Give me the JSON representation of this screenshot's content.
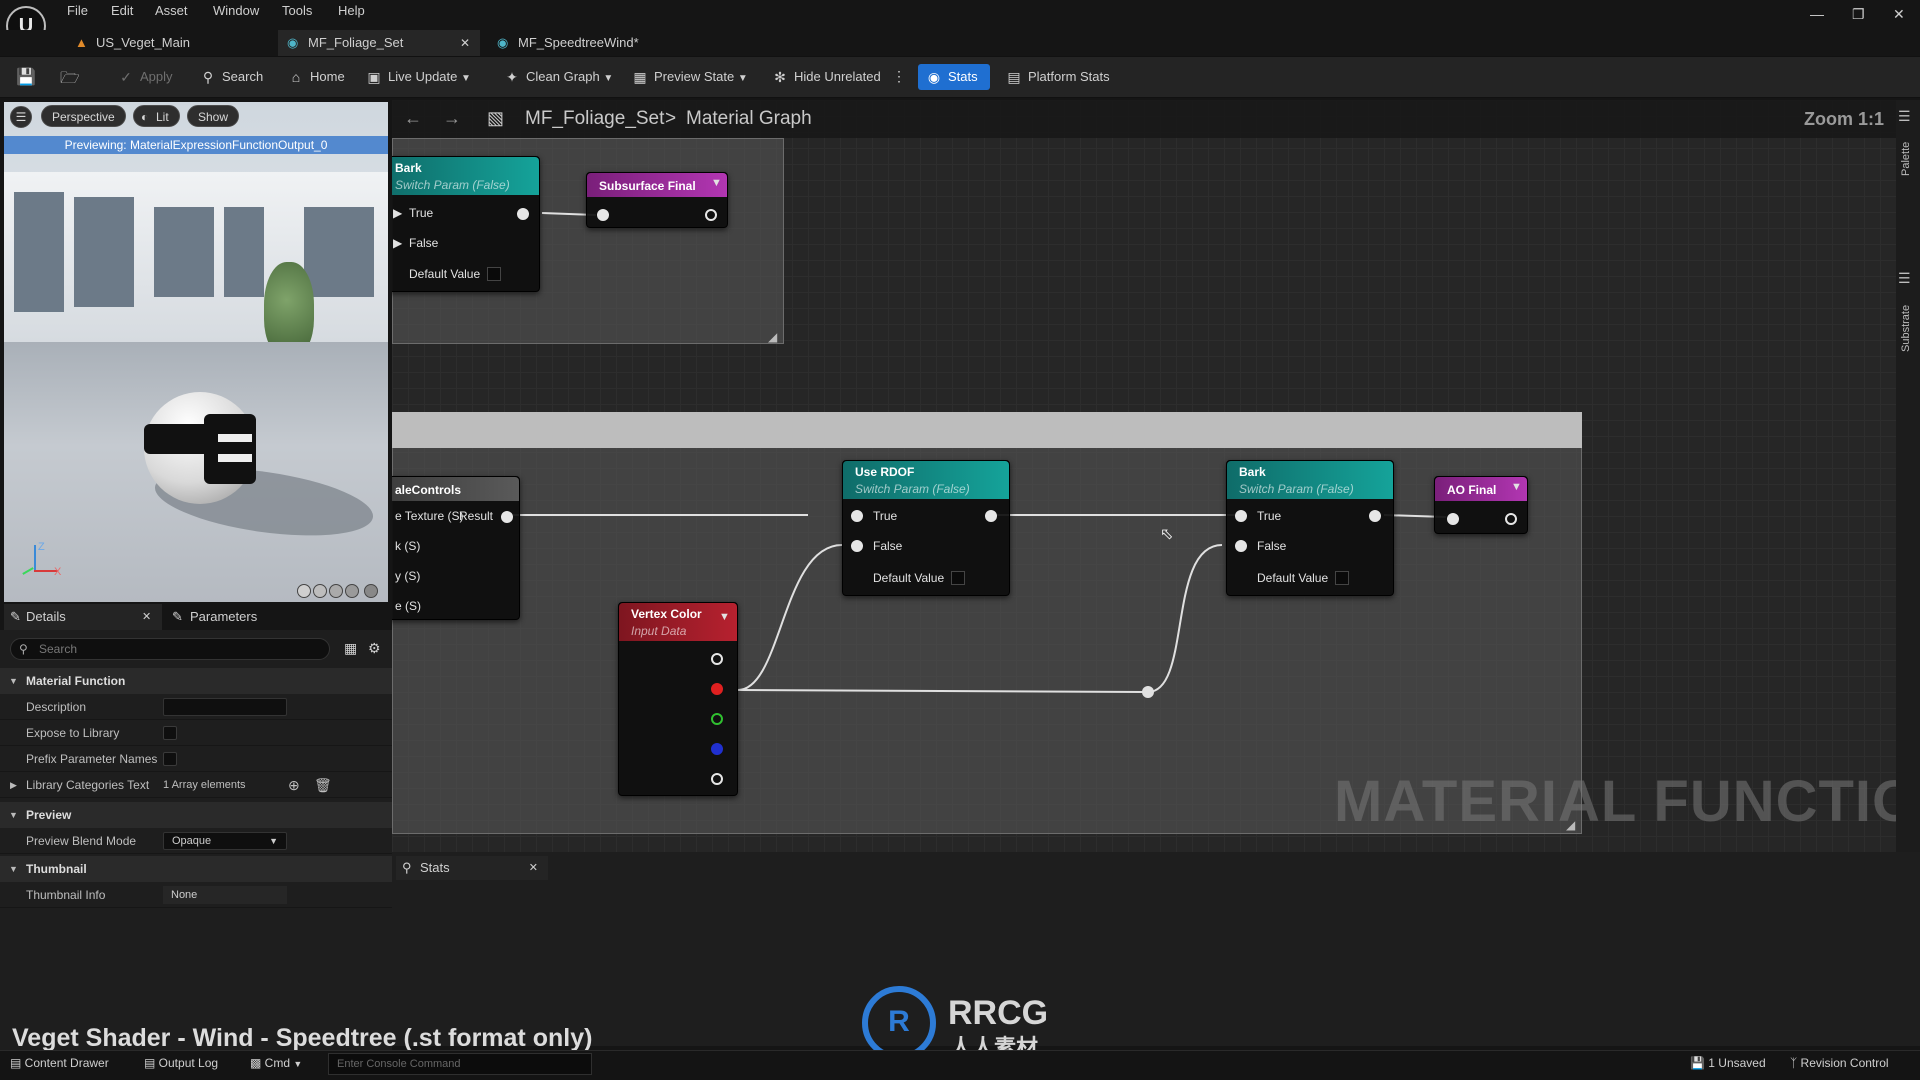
{
  "menu": [
    "File",
    "Edit",
    "Asset",
    "Window",
    "Tools",
    "Help"
  ],
  "tabs": [
    {
      "label": "US_Veget_Main",
      "active": false,
      "closable": false
    },
    {
      "label": "MF_Foliage_Set",
      "active": true,
      "closable": true
    },
    {
      "label": "MF_SpeedtreeWind*",
      "active": false,
      "closable": false
    }
  ],
  "toolbar": {
    "apply": "Apply",
    "search": "Search",
    "home": "Home",
    "live_update": "Live Update",
    "clean_graph": "Clean Graph",
    "preview_state": "Preview State",
    "hide_unrelated": "Hide Unrelated",
    "stats": "Stats",
    "platform_stats": "Platform Stats"
  },
  "viewport": {
    "perspective": "Perspective",
    "lit": "Lit",
    "show": "Show",
    "preview_label": "Previewing: MaterialExpressionFunctionOutput_0",
    "axis_z": "Z",
    "axis_x": "X"
  },
  "details": {
    "tab_details": "Details",
    "tab_parameters": "Parameters",
    "search_placeholder": "Search",
    "sections": {
      "material_function": "Material Function",
      "preview": "Preview",
      "thumbnail": "Thumbnail"
    },
    "rows": {
      "description": "Description",
      "expose": "Expose to Library",
      "prefix": "Prefix Parameter Names",
      "library_categories": "Library Categories Text",
      "library_categories_value": "1 Array elements",
      "preview_blend_mode": "Preview Blend Mode",
      "preview_blend_mode_value": "Opaque",
      "thumbnail_info": "Thumbnail Info",
      "thumbnail_info_value": "None"
    }
  },
  "graph": {
    "breadcrumb_asset": "MF_Foliage_Set",
    "breadcrumb_sep": ">",
    "breadcrumb_graph": "Material Graph",
    "zoom": "Zoom 1:1",
    "watermark_label": "MATERIAL FUNCTION",
    "nodes": {
      "bark_top": {
        "title": "Bark",
        "subtitle": "Switch Param (False)",
        "true": "True",
        "false": "False",
        "default": "Default Value"
      },
      "subsurface_final": {
        "title": "Subsurface Final"
      },
      "scale_controls": {
        "title": "aleControls",
        "in1": "e Texture (S)",
        "out": "Result",
        "in2": "k (S)",
        "in3": "y (S)",
        "in4": "e (S)"
      },
      "use_rdof": {
        "title": "Use RDOF",
        "subtitle": "Switch Param (False)",
        "true": "True",
        "false": "False",
        "default": "Default Value"
      },
      "vertex_color": {
        "title": "Vertex Color",
        "subtitle": "Input Data"
      },
      "bark_bottom": {
        "title": "Bark",
        "subtitle": "Switch Param (False)",
        "true": "True",
        "false": "False",
        "default": "Default Value"
      },
      "ao_final": {
        "title": "AO Final"
      }
    },
    "colors": {
      "switch_header": "#0f8f8a",
      "output_header": "#9a2a9a",
      "input_header": "#a52030",
      "pin_red": "#e02020",
      "pin_green": "#30c030",
      "pin_blue": "#2030d0"
    }
  },
  "right_strip": {
    "palette": "Palette",
    "substrate": "Substrate"
  },
  "stats_panel": {
    "tab": "Stats"
  },
  "statusbar": {
    "content_drawer": "Content Drawer",
    "output_log": "Output Log",
    "cmd": "Cmd",
    "console_placeholder": "Enter Console Command",
    "unsaved": "1 Unsaved",
    "revision": "Revision Control"
  },
  "caption": "Veget Shader - Wind - Speedtree (.st format only)",
  "watermark": {
    "logo": "R",
    "name": "RRCG",
    "sub": "人人素材"
  }
}
